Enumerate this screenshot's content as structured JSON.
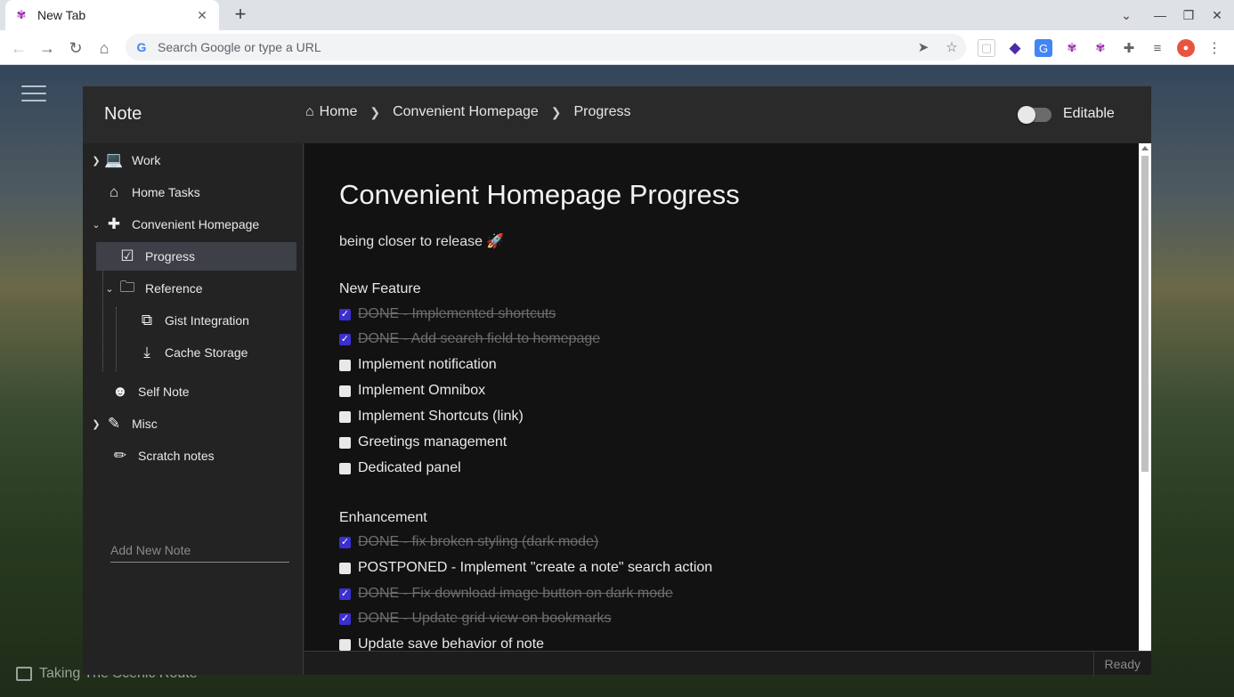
{
  "browser": {
    "tab_title": "New Tab",
    "new_tab": "+",
    "omnibox_placeholder": "Search Google or type a URL",
    "window_controls": {
      "tabs_menu": "⌄",
      "minimize": "—",
      "restore": "❐",
      "close": "✕"
    }
  },
  "wallpaper": {
    "credit": "Taking The Scenic Route"
  },
  "app": {
    "title": "Note",
    "breadcrumbs": [
      "Home",
      "Convenient Homepage",
      "Progress"
    ],
    "editable_label": "Editable",
    "editable_on": false
  },
  "sidebar": {
    "items": [
      {
        "label": "Work",
        "icon": "laptop-icon"
      },
      {
        "label": "Home Tasks",
        "icon": "home-icon"
      },
      {
        "label": "Convenient Homepage",
        "icon": "puzzle-icon"
      },
      {
        "label": "Progress",
        "icon": "checklist-icon"
      },
      {
        "label": "Reference",
        "icon": "folder-icon"
      },
      {
        "label": "Gist Integration",
        "icon": "code-icon"
      },
      {
        "label": "Cache Storage",
        "icon": "download-icon"
      },
      {
        "label": "Self Note",
        "icon": "contact-icon"
      },
      {
        "label": "Misc",
        "icon": "note-edit-icon"
      },
      {
        "label": "Scratch notes",
        "icon": "pencil-icon"
      }
    ],
    "add_placeholder": "Add New Note"
  },
  "page": {
    "title": "Convenient Homepage Progress",
    "subtitle": "being closer to release 🚀",
    "sections": [
      {
        "heading": "New Feature",
        "tasks": [
          {
            "text": "DONE - Implemented shortcuts",
            "done": true
          },
          {
            "text": "DONE - Add search field to homepage",
            "done": true
          },
          {
            "text": "Implement notification",
            "done": false
          },
          {
            "text": "Implement Omnibox",
            "done": false
          },
          {
            "text": "Implement Shortcuts (link)",
            "done": false
          },
          {
            "text": "Greetings management",
            "done": false
          },
          {
            "text": "Dedicated panel",
            "done": false
          }
        ]
      },
      {
        "heading": "Enhancement",
        "tasks": [
          {
            "text": "DONE - fix broken styling (dark mode)",
            "done": true
          },
          {
            "text": "POSTPONED - Implement \"create a note\" search action",
            "done": false
          },
          {
            "text": "DONE - Fix download image button on dark mode",
            "done": true
          },
          {
            "text": "DONE - Update grid view on bookmarks",
            "done": true
          },
          {
            "text": "Update save behavior of note",
            "done": false
          }
        ]
      }
    ]
  },
  "status": {
    "text": "Ready"
  }
}
